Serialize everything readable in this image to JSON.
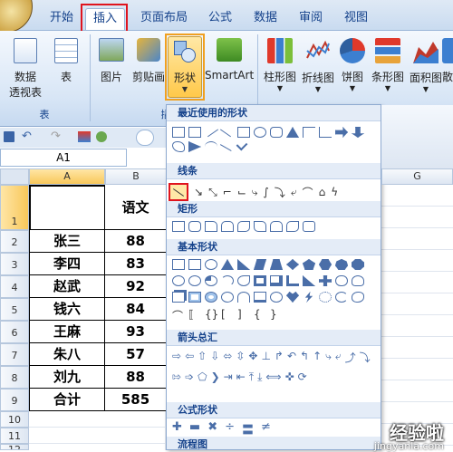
{
  "ribbon_tabs": [
    "开始",
    "插入",
    "页面布局",
    "公式",
    "数据",
    "审阅",
    "视图"
  ],
  "active_tab": "插入",
  "ribbon": {
    "pivot_label_1": "数据",
    "pivot_label_2": "透视表",
    "table_label": "表",
    "group_tables": "表",
    "picture_label": "图片",
    "clipart_label": "剪贴画",
    "shapes_label": "形状",
    "smartart_label": "SmartArt",
    "group_illus_partial": "插",
    "column_chart": "柱形图",
    "line_chart": "折线图",
    "pie_chart": "饼图",
    "bar_chart": "条形图",
    "area_chart": "面积图",
    "scatter_partial": "散"
  },
  "namebox": "A1",
  "columns": [
    "A",
    "B",
    "G"
  ],
  "rows": [
    "1",
    "2",
    "3",
    "4",
    "5",
    "6",
    "7",
    "8",
    "9",
    "10",
    "11",
    "12"
  ],
  "table": {
    "header": [
      "",
      "语文"
    ],
    "rows": [
      [
        "张三",
        "88"
      ],
      [
        "李四",
        "83"
      ],
      [
        "赵武",
        "92"
      ],
      [
        "钱六",
        "84"
      ],
      [
        "王麻",
        "93"
      ],
      [
        "朱八",
        "57"
      ],
      [
        "刘九",
        "88"
      ],
      [
        "合计",
        "585"
      ]
    ]
  },
  "dropdown": {
    "recent_title": "最近使用的形状",
    "lines_title": "线条",
    "rect_title": "矩形",
    "basic_title": "基本形状",
    "arrows_title": "箭头总汇",
    "formula_title": "公式形状",
    "flow_title": "流程图"
  },
  "watermark": {
    "main": "经验啦",
    "sub": "jingyanla.com"
  },
  "colors": {
    "accent_red": "#e0141e",
    "ribbon_text": "#15428b"
  }
}
